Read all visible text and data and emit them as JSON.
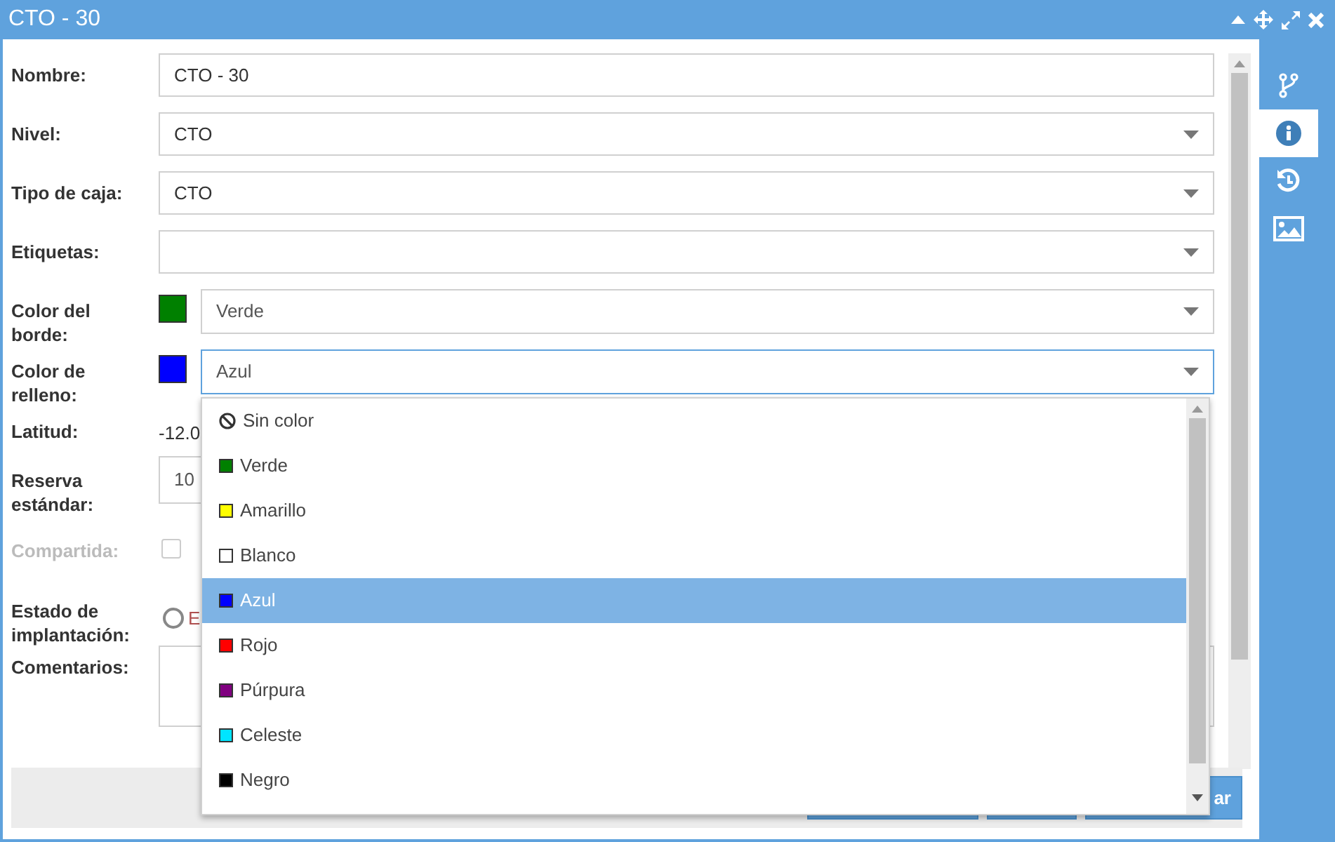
{
  "window": {
    "title": "CTO - 30"
  },
  "sidebar": {
    "tabs": [
      {
        "kind": "branch",
        "selected": false
      },
      {
        "kind": "info",
        "selected": true
      },
      {
        "kind": "history",
        "selected": false
      },
      {
        "kind": "image",
        "selected": false
      }
    ]
  },
  "fields": [
    {
      "kind": "text",
      "label": "Nombre:",
      "value": "CTO - 30"
    },
    {
      "kind": "select",
      "label": "Nivel:",
      "value": "CTO"
    },
    {
      "kind": "select",
      "label": "Tipo de caja:",
      "value": "CTO"
    },
    {
      "kind": "select",
      "label": "Etiquetas:"
    },
    {
      "kind": "color_select",
      "label": "Color del borde:",
      "color": "#008000",
      "value": "Verde",
      "focused": false
    },
    {
      "kind": "color_select",
      "label": "Color de relleno:",
      "color": "#0000ff",
      "value": "Azul",
      "focused": true
    },
    {
      "kind": "readout",
      "label": "Latitud:",
      "value": "-12.0"
    },
    {
      "kind": "number",
      "label": "Reserva estándar:",
      "value": "10"
    },
    {
      "kind": "checkbox",
      "label": "Compartida:",
      "checked": false,
      "disabled": true
    },
    {
      "kind": "radio",
      "label": "Estado de implantación:",
      "option": "E",
      "selected": false
    },
    {
      "kind": "textarea",
      "label": "Comentarios:"
    }
  ],
  "dropdown": {
    "options": [
      {
        "kind": "none",
        "label": "Sin color",
        "selected": false
      },
      {
        "kind": "swatch",
        "label": "Verde",
        "color": "#008000",
        "selected": false
      },
      {
        "kind": "swatch",
        "label": "Amarillo",
        "color": "#ffff00",
        "selected": false
      },
      {
        "kind": "swatch",
        "label": "Blanco",
        "color": "#ffffff",
        "selected": false
      },
      {
        "kind": "swatch",
        "label": "Azul",
        "color": "#0000ff",
        "selected": true
      },
      {
        "kind": "swatch",
        "label": "Rojo",
        "color": "#ff0000",
        "selected": false
      },
      {
        "kind": "swatch",
        "label": "Púrpura",
        "color": "#800080",
        "selected": false
      },
      {
        "kind": "swatch",
        "label": "Celeste",
        "color": "#00e5ff",
        "selected": false
      },
      {
        "kind": "swatch",
        "label": "Negro",
        "color": "#000000",
        "selected": false
      }
    ]
  },
  "buttons": [
    {
      "kind": "blank"
    },
    {
      "kind": "blank"
    },
    {
      "kind": "labeled",
      "label": "ar"
    }
  ]
}
